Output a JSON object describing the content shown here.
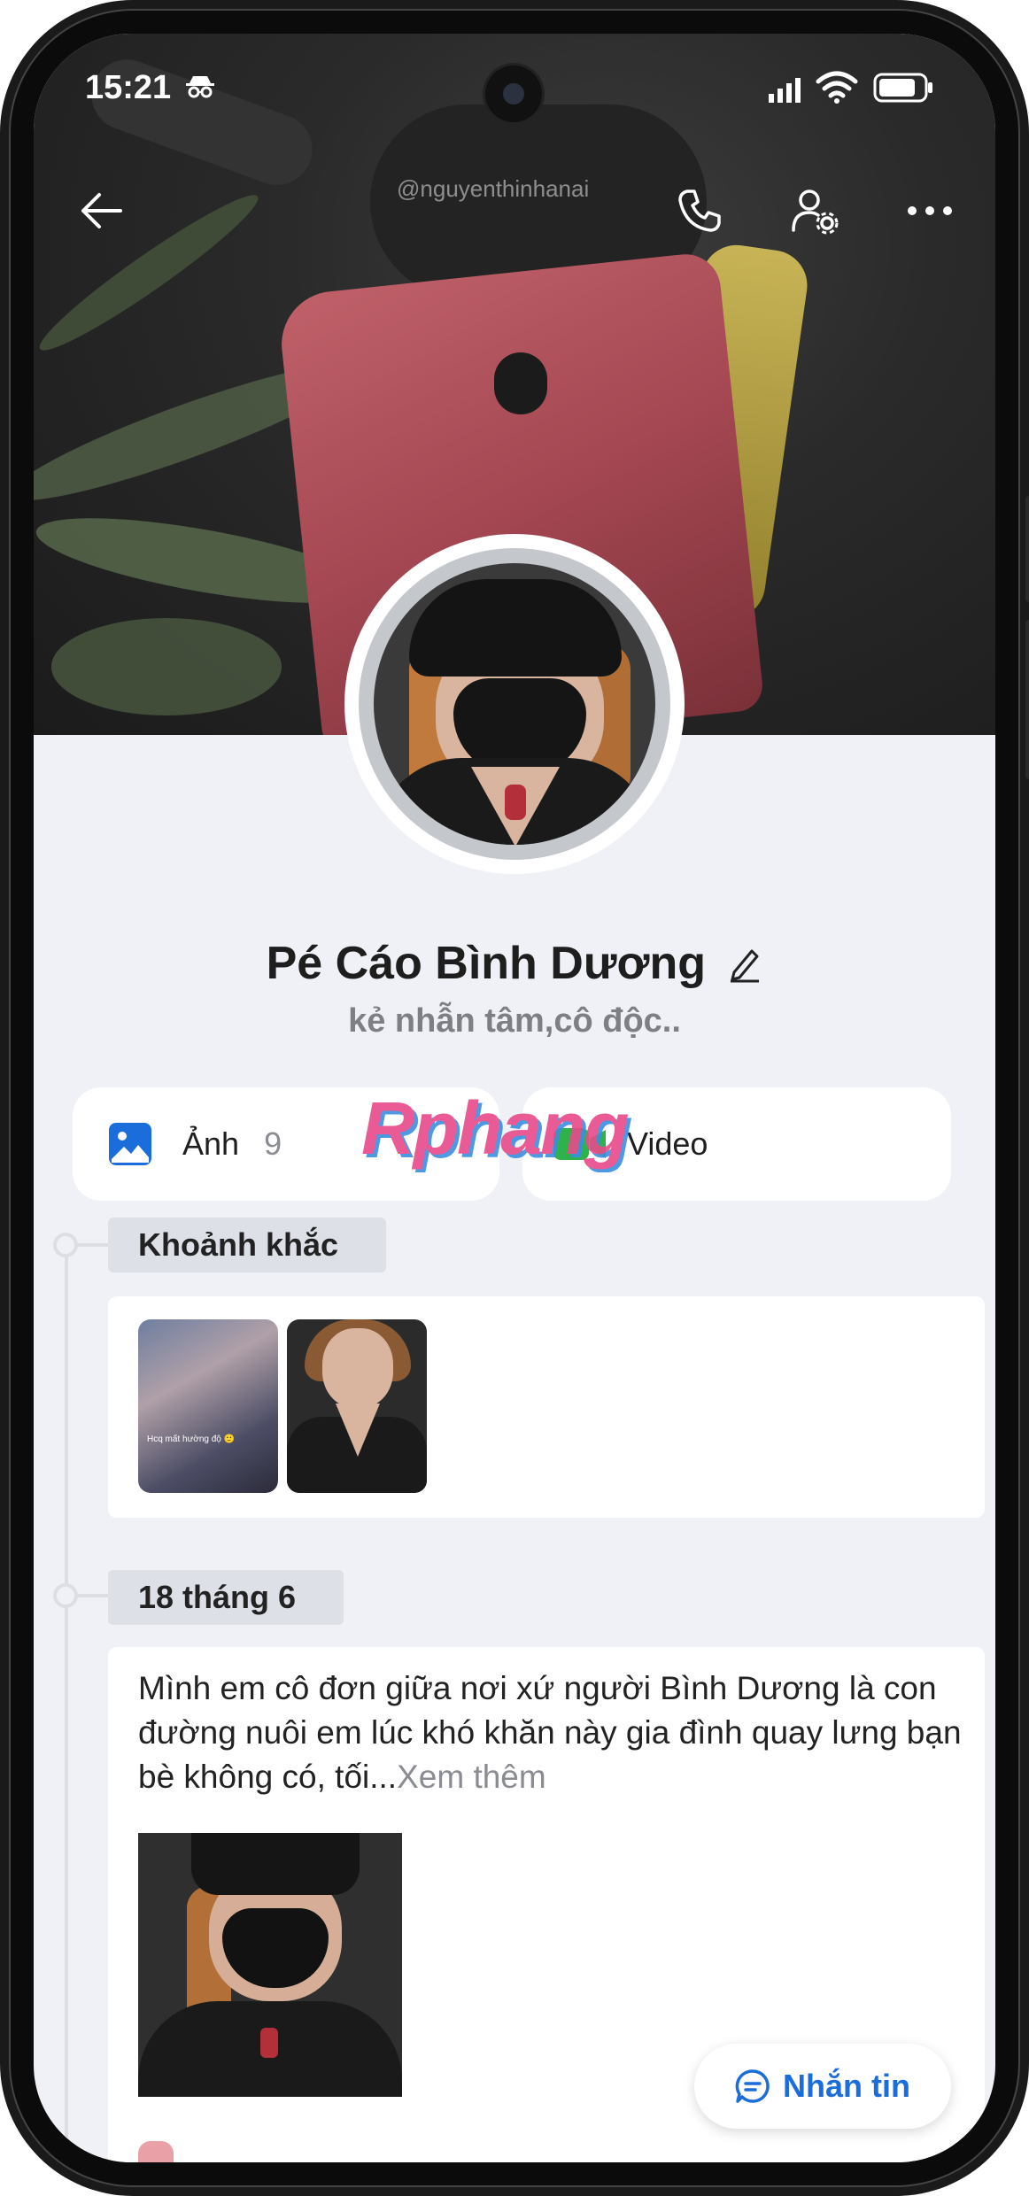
{
  "status_bar": {
    "time": "15:21"
  },
  "cover": {
    "watermark_text": "@nguyenthinhanai"
  },
  "profile": {
    "name": "Pé Cáo Bình Dương",
    "bio": "kẻ nhẫn tâm,cô độc.."
  },
  "media": {
    "photos_label": "Ảnh",
    "photos_count": "9",
    "video_label": "Video"
  },
  "overlay_watermark": "Rphang",
  "moments": {
    "title": "Khoảnh khắc",
    "thumb1_caption": "Hcq mất hường độ 🙂"
  },
  "post": {
    "date_title": "18 tháng 6",
    "text": "Mình em cô đơn giữa nơi xứ người Bình Dương là con đường nuôi em lúc khó khăn này gia đình quay lưng bạn bè không có, tối...",
    "more_label": "Xem thêm"
  },
  "message_button": {
    "label": "Nhắn tin"
  },
  "colors": {
    "accent_blue": "#1a6ddb",
    "photo_icon_blue": "#1a6ddb",
    "video_icon_green": "#2fb24c",
    "page_bg": "#eff1f6"
  }
}
